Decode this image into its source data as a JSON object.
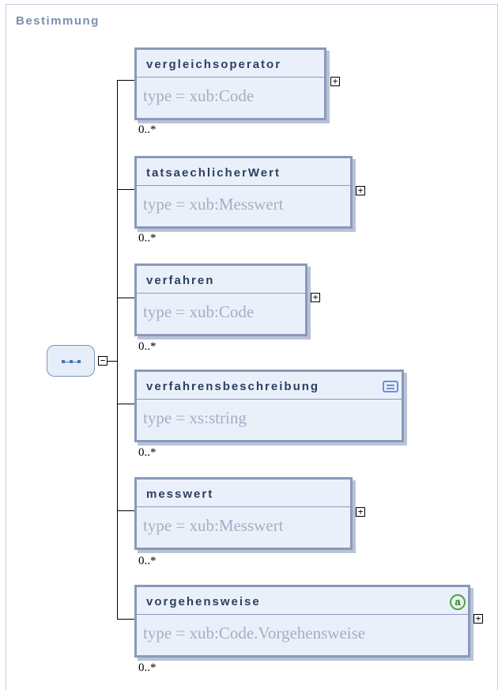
{
  "panel": {
    "title": "Bestimmung"
  },
  "sequence": {
    "icon": "sequence-icon",
    "toggle": "−"
  },
  "elements": [
    {
      "name": "vergleichsoperator",
      "type": "type = xub:Code",
      "cardinality": "0..*",
      "expand": "+"
    },
    {
      "name": "tatsaechlicherWert",
      "type": "type = xub:Messwert",
      "cardinality": "0..*",
      "expand": "+"
    },
    {
      "name": "verfahren",
      "type": "type = xub:Code",
      "cardinality": "0..*",
      "expand": "+"
    },
    {
      "name": "verfahrensbeschreibung",
      "type": "type = xs:string",
      "cardinality": "0..*",
      "icon": "documentation-icon"
    },
    {
      "name": "messwert",
      "type": "type = xub:Messwert",
      "cardinality": "0..*",
      "expand": "+"
    },
    {
      "name": "vorgehensweise",
      "type": "type = xub:Code.Vorgehensweise",
      "cardinality": "0..*",
      "expand": "+",
      "icon": "attribute-icon",
      "icon_text": "a"
    }
  ],
  "colors": {
    "border": "#8a99ba",
    "fill": "#eaf0fa",
    "name_text": "#2e3f62",
    "type_text": "#a4afc4",
    "title_text": "#7d8fae"
  }
}
